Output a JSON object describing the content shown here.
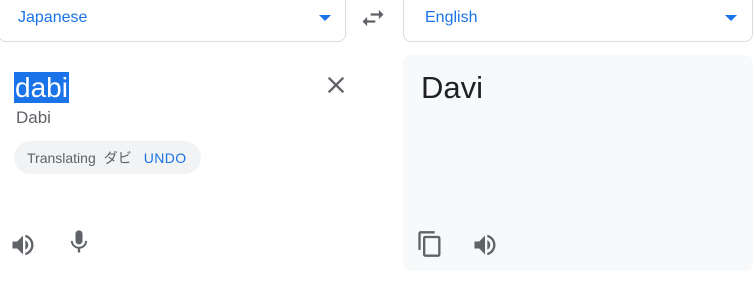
{
  "source_language": {
    "label": "Japanese"
  },
  "target_language": {
    "label": "English"
  },
  "source": {
    "text": "dabi",
    "romanization": "Dabi",
    "translating_label": "Translating",
    "translating_word": "ダビ",
    "undo_label": "UNDO"
  },
  "target": {
    "text": "Davi"
  },
  "icons": {
    "swap": "swap-languages-icon",
    "clear": "close-icon",
    "source_listen": "speaker-icon",
    "source_voice": "microphone-icon",
    "copy": "copy-icon",
    "target_listen": "speaker-icon"
  },
  "colors": {
    "accent": "#1a73e8",
    "panel_bg": "#f8f9fa",
    "chip_bg": "#f1f3f4",
    "icon": "#5f6368"
  }
}
